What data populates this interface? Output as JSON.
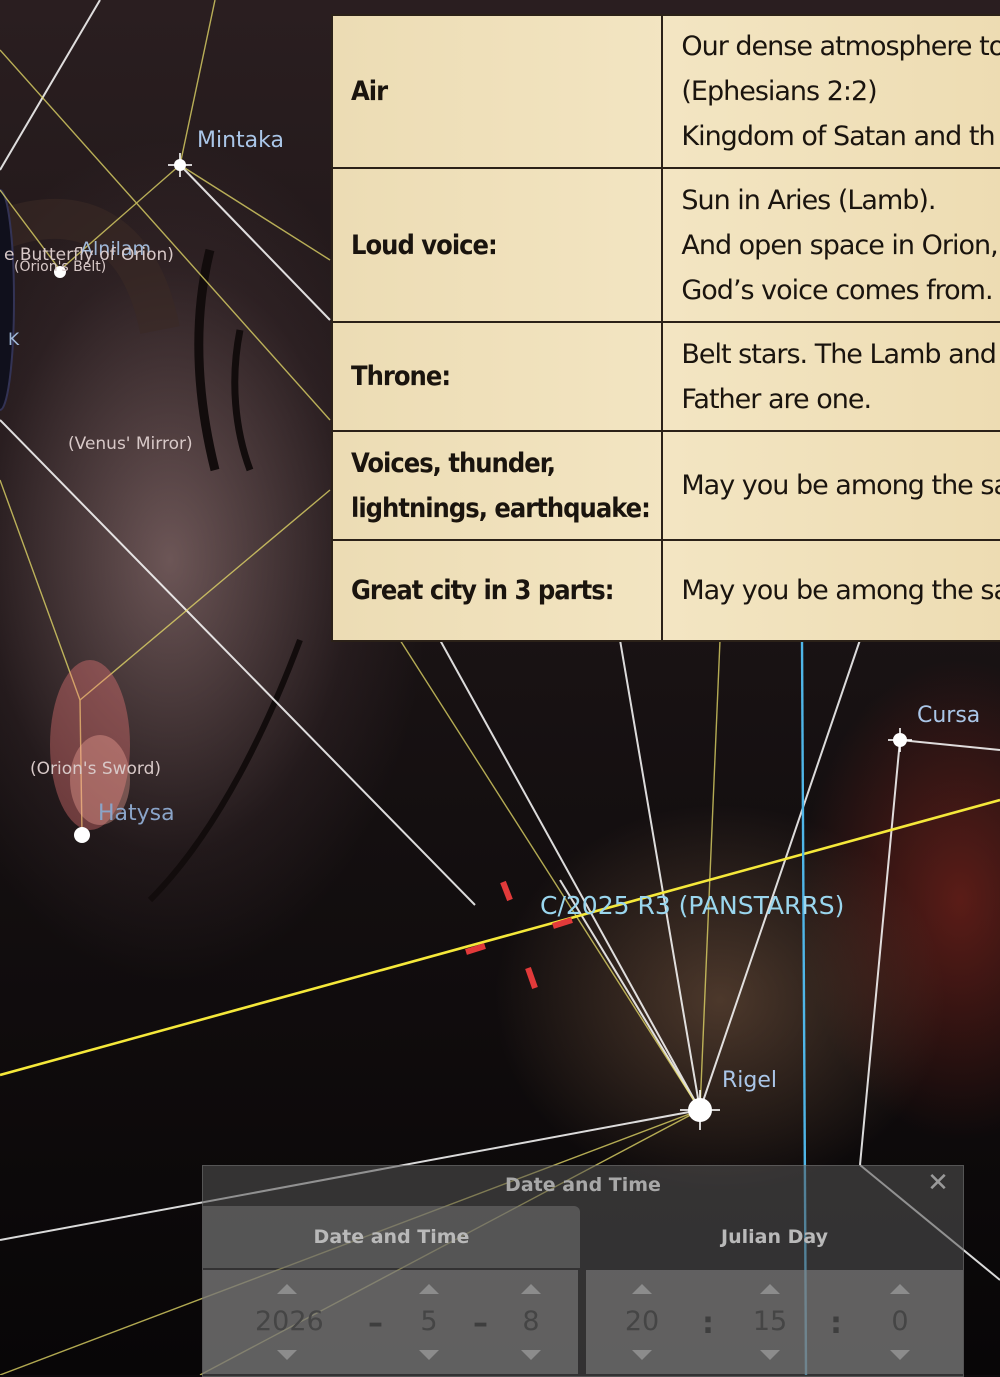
{
  "table": {
    "rows": [
      {
        "label": "Air",
        "lines": [
          "Our dense atmosphere to",
          "(Ephesians 2:2)",
          "Kingdom of Satan and th"
        ]
      },
      {
        "label": "Loud voice:",
        "lines": [
          "Sun in Aries (Lamb).",
          "And open space in Orion,",
          "God’s voice comes from."
        ]
      },
      {
        "label": "Throne:",
        "lines": [
          "Belt stars. The Lamb and",
          "Father are one."
        ]
      },
      {
        "label": "Voices, thunder, lightnings, earthquake:",
        "label_lines": [
          "Voices, thunder,",
          "lightnings, earthquake:"
        ],
        "lines": [
          "May you be among the sa"
        ]
      },
      {
        "label": "Great city in 3 parts:",
        "lines": [
          "May you be among the sa"
        ]
      }
    ]
  },
  "sky_labels": {
    "mintaka": "Mintaka",
    "alnilam_overlap": "Alnilam",
    "butterfly": "e Butterfly of Orion)",
    "orions_belt": "(Orion's Belt)",
    "venus_mirror": "(Venus' Mirror)",
    "orions_sword": "(Orion's Sword)",
    "hatysa": "Hatysa",
    "cursa": "Cursa",
    "rigel": "Rigel",
    "comet": "C/2025 R3 (PANSTARRS)",
    "k_fragment": "K"
  },
  "dialog": {
    "title": "Date and Time",
    "tabs": [
      "Date and Time",
      "Julian Day"
    ],
    "date": {
      "year": "2026",
      "month": "5",
      "day": "8",
      "sep": "–"
    },
    "time": {
      "hour": "20",
      "minute": "15",
      "second": "0",
      "sep": ":"
    },
    "close_glyph": "✕"
  },
  "colors": {
    "constellation_lines": "#ffffff",
    "ecliptic": "#f5e83a",
    "meridian": "#4fb6e8",
    "comet_marker": "#e23a3a",
    "table_bg": "#efe0ba"
  }
}
